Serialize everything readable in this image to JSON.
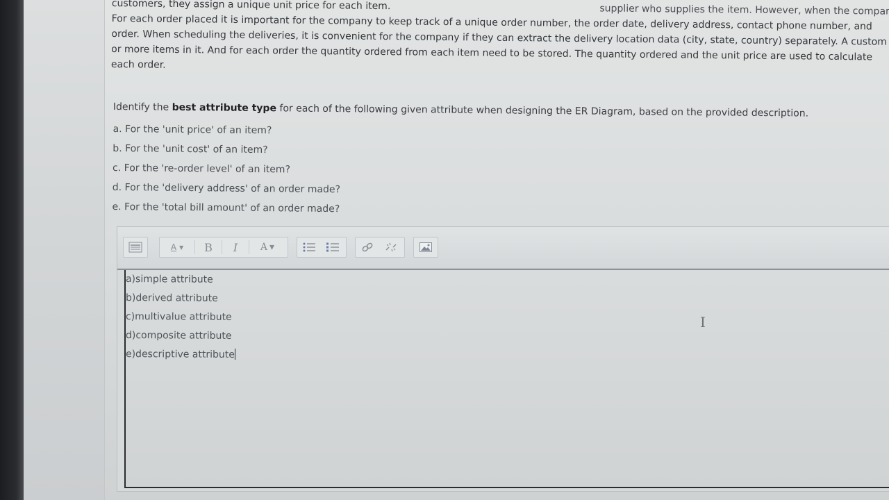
{
  "description": {
    "line1_left": "customers, they assign a unique unit price for each item.",
    "line1_right": "supplier who supplies the item. However, when the compar",
    "line2": "For each order placed it is important for the company to keep track of a unique order number, the order date, delivery address, contact phone number, and",
    "line3": "order. When scheduling the deliveries, it is convenient for the company if they can extract the delivery location data (city, state, country) separately. A custom",
    "line4": "or more items in it. And for each order the quantity ordered from each item need to be stored. The quantity ordered and the unit price are used to calculate",
    "line5": "each order."
  },
  "prompt": {
    "intro_pre": "Identify the ",
    "intro_bold": "best attribute type",
    "intro_post": " for each of the following given attribute when designing the ER Diagram, based on the provided description.",
    "items": [
      "a. For the 'unit price' of an item?",
      "b. For the 'unit cost' of an item?",
      "c. For the 're-order level' of an item?",
      "d. For the 'delivery address' of an order made?",
      "e. For the 'total bill amount' of an order made?"
    ]
  },
  "toolbar": {
    "font_size_label": "A",
    "bold_label": "B",
    "italic_label": "I",
    "font_color_label": "A",
    "dropdown_glyph": "▾"
  },
  "answer": {
    "lines": [
      "a)simple attribute",
      "b)derived attribute",
      "c)multivalue attribute",
      "d)composite attribute",
      "e)descriptive attribute"
    ]
  }
}
